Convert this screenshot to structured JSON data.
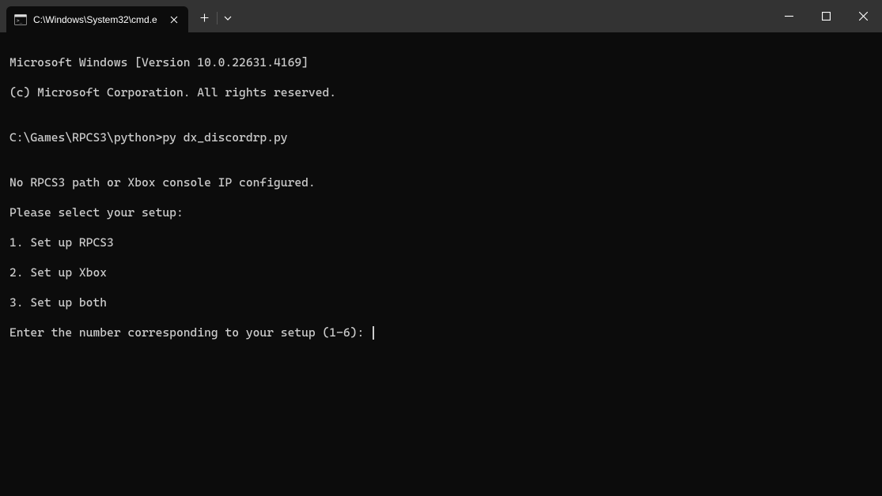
{
  "titlebar": {
    "tab": {
      "title": "C:\\Windows\\System32\\cmd.e",
      "icon": "cmd-icon"
    }
  },
  "terminal": {
    "lines": [
      "Microsoft Windows [Version 10.0.22631.4169]",
      "(c) Microsoft Corporation. All rights reserved.",
      "",
      "C:\\Games\\RPCS3\\python>py dx_discordrp.py",
      "",
      "No RPCS3 path or Xbox console IP configured.",
      "Please select your setup:",
      "1. Set up RPCS3",
      "2. Set up Xbox",
      "3. Set up both"
    ],
    "prompt": "Enter the number corresponding to your setup (1-6): "
  }
}
